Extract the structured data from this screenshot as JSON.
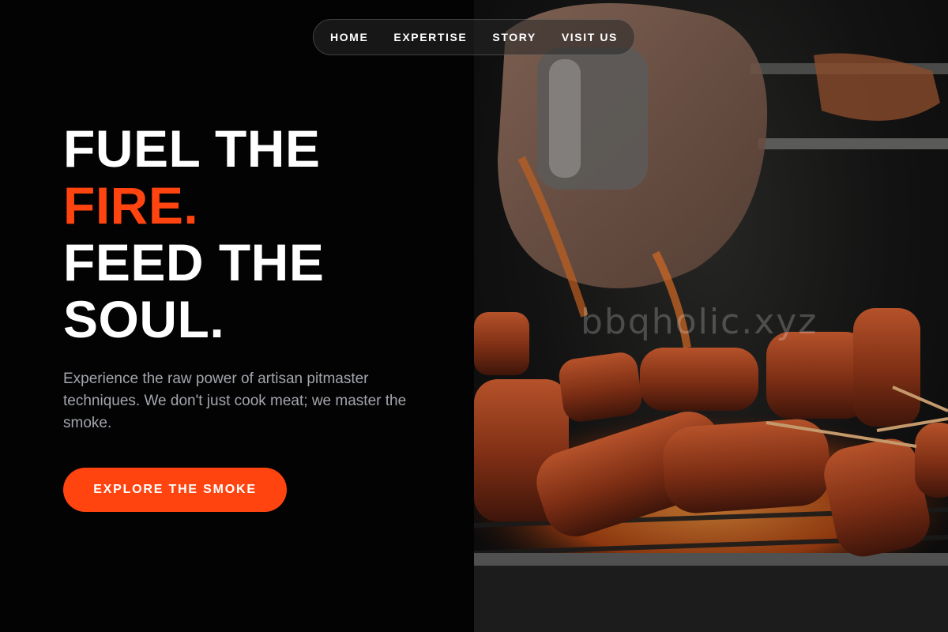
{
  "nav": {
    "items": [
      {
        "label": "HOME"
      },
      {
        "label": "EXPERTISE"
      },
      {
        "label": "STORY"
      },
      {
        "label": "VISIT US"
      }
    ]
  },
  "hero": {
    "headline": {
      "line1": "FUEL THE",
      "line2": "FIRE.",
      "line3": "FEED THE",
      "line4": "SOUL."
    },
    "subtitle": "Experience the raw power of artisan pitmaster techniques. We don't just cook meat; we master the smoke.",
    "cta_label": "EXPLORE THE SMOKE"
  },
  "photo": {
    "watermark": "bbqholic.xyz"
  },
  "colors": {
    "accent": "#ff4410",
    "background": "#030303",
    "text_primary": "#ffffff",
    "text_muted": "#a3a6ad"
  }
}
